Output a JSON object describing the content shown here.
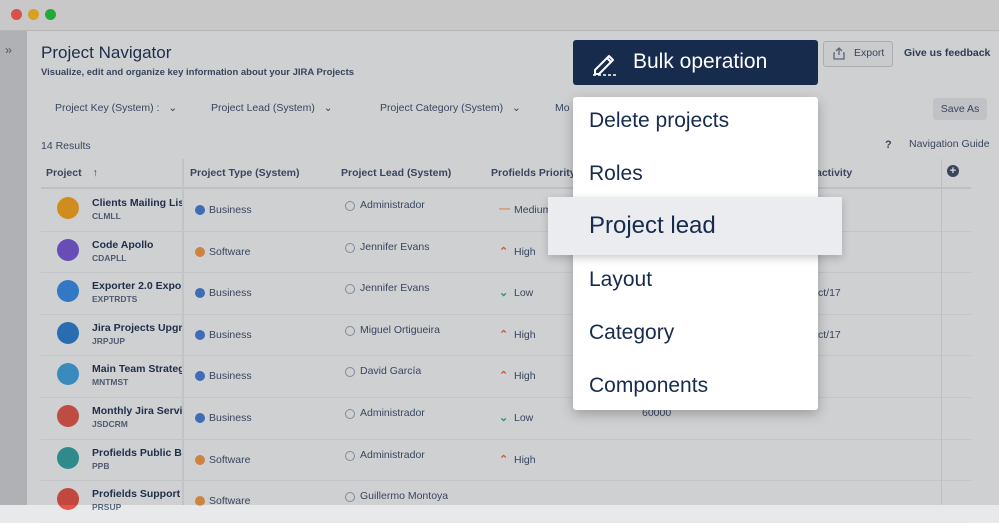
{
  "window": {
    "dots": [
      "#ff5f57",
      "#febc2e",
      "#28c840"
    ]
  },
  "rail": {
    "expand_glyph": "››"
  },
  "header": {
    "title": "Project Navigator",
    "subtitle": "Visualize, edit and organize key information about your JIRA Projects",
    "export_label": "Export",
    "feedback_label": "Give us feedback"
  },
  "filters": [
    {
      "label": "Project Key (System) :"
    },
    {
      "label": "Project Lead (System)"
    },
    {
      "label": "Project Category (System)"
    },
    {
      "label": "Mo"
    }
  ],
  "save_as_label": "Save As",
  "results_label": "14 Results",
  "help_glyph": "?",
  "nav_guide_label": "Navigation Guide",
  "columns": [
    "Project",
    "Project Type (System)",
    "Project Lead (System)",
    "Profields Priority",
    "activity"
  ],
  "rows": [
    {
      "name": "Clients Mailing List",
      "key": "CLMLL",
      "type": "Business",
      "type_color": "#4c7ed6",
      "lead": "Administrador",
      "priority": "Medium",
      "prio_icon": "—",
      "prio_color": "#f5a54a",
      "avatar": "#f5a623",
      "extra": ""
    },
    {
      "name": "Code Apollo",
      "key": "CDAPLL",
      "type": "Software",
      "type_color": "#f29b4b",
      "lead": "Jennifer Evans",
      "priority": "High",
      "prio_icon": "⌃",
      "prio_color": "#ef6b4a",
      "avatar": "#7b5bd6",
      "extra": ""
    },
    {
      "name": "Exporter 2.0 Expo...",
      "key": "EXPTRDTS",
      "type": "Business",
      "type_color": "#4c7ed6",
      "lead": "Jennifer Evans",
      "priority": "Low",
      "prio_icon": "⌄",
      "prio_color": "#36b37e",
      "avatar": "#3b8ee8",
      "extra": "ct/17"
    },
    {
      "name": "Jira Projects Upgr...",
      "key": "JRPJUP",
      "type": "Business",
      "type_color": "#4c7ed6",
      "lead": "Miguel Ortigueira",
      "priority": "High",
      "prio_icon": "⌃",
      "prio_color": "#ef6b4a",
      "avatar": "#2f80d1",
      "extra": "ct/17"
    },
    {
      "name": "Main Team Strateg...",
      "key": "MNTMST",
      "type": "Business",
      "type_color": "#4c7ed6",
      "lead": "David García",
      "priority": "High",
      "prio_icon": "⌃",
      "prio_color": "#ef6b4a",
      "avatar": "#46a3e0",
      "extra": ""
    },
    {
      "name": "Monthly Jira Servi...",
      "key": "JSDCRM",
      "type": "Business",
      "type_color": "#4c7ed6",
      "lead": "Administrador",
      "priority": "Low",
      "prio_icon": "⌄",
      "prio_color": "#36b37e",
      "avatar": "#e05a4f",
      "extra": "60000"
    },
    {
      "name": "Profields Public B...",
      "key": "PPB",
      "type": "Software",
      "type_color": "#f29b4b",
      "lead": "Administrador",
      "priority": "High",
      "prio_icon": "⌃",
      "prio_color": "#ef6b4a",
      "avatar": "#38a3a5",
      "extra": ""
    },
    {
      "name": "Profields Support",
      "key": "PRSUP",
      "type": "Software",
      "type_color": "#f29b4b",
      "lead": "Guillermo Montoya",
      "priority": "",
      "prio_icon": "",
      "prio_color": "#ef6b4a",
      "avatar": "#e4554a",
      "extra": ""
    }
  ],
  "bulk": {
    "label": "Bulk operation"
  },
  "menu": {
    "items": [
      "Delete projects",
      "Roles",
      "Project lead",
      "Layout",
      "Category",
      "Components"
    ],
    "highlighted": "Project lead"
  }
}
